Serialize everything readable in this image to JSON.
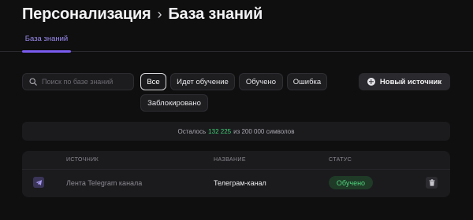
{
  "breadcrumb": {
    "root": "Персонализация",
    "separator": "›",
    "current": "База знаний"
  },
  "tabs": [
    {
      "label": "База знаний",
      "active": true
    }
  ],
  "search": {
    "placeholder": "Поиск по базе знаний",
    "value": ""
  },
  "filters": [
    {
      "label": "Все",
      "active": true
    },
    {
      "label": "Идет обучение",
      "active": false
    },
    {
      "label": "Обучено",
      "active": false
    },
    {
      "label": "Ошибка",
      "active": false
    },
    {
      "label": "Заблокировано",
      "active": false
    }
  ],
  "new_source_button": {
    "label": "Новый источник",
    "icon": "plus-circle-icon"
  },
  "quota": {
    "prefix": "Осталось",
    "remaining": "132 225",
    "suffix": "из 200 000 символов"
  },
  "table": {
    "columns": [
      "Источник",
      "Название",
      "Статус"
    ],
    "rows": [
      {
        "source_icon": "telegram-icon",
        "source": "Лента Telegram канала",
        "name": "Телеграм-канал",
        "status": "Обучено",
        "action_icon": "trash-icon"
      }
    ]
  },
  "colors": {
    "background": "#0f0f10",
    "accent": "#7b5cf0",
    "success": "#3ecf72",
    "panel": "#1b1b1e"
  }
}
